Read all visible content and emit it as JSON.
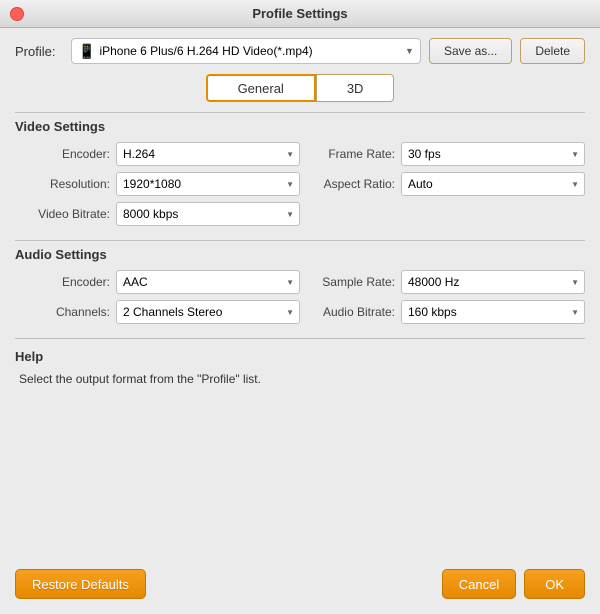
{
  "titleBar": {
    "title": "Profile Settings"
  },
  "profileRow": {
    "label": "Profile:",
    "selectedValue": "iPhone 6 Plus/6 H.264 HD Video(*.mp4)",
    "saveAsLabel": "Save as...",
    "deleteLabel": "Delete"
  },
  "tabs": [
    {
      "id": "general",
      "label": "General",
      "active": true
    },
    {
      "id": "3d",
      "label": "3D",
      "active": false
    }
  ],
  "videoSettings": {
    "title": "Video Settings",
    "fields": [
      {
        "label": "Encoder:",
        "value": "H.264",
        "col": 0
      },
      {
        "label": "Frame Rate:",
        "value": "30 fps",
        "col": 1
      },
      {
        "label": "Resolution:",
        "value": "1920*1080",
        "col": 0
      },
      {
        "label": "Aspect Ratio:",
        "value": "Auto",
        "col": 1
      },
      {
        "label": "Video Bitrate:",
        "value": "8000 kbps",
        "col": 0
      }
    ]
  },
  "audioSettings": {
    "title": "Audio Settings",
    "fields": [
      {
        "label": "Encoder:",
        "value": "AAC",
        "col": 0
      },
      {
        "label": "Sample Rate:",
        "value": "48000 Hz",
        "col": 1
      },
      {
        "label": "Channels:",
        "value": "2 Channels Stereo",
        "col": 0
      },
      {
        "label": "Audio Bitrate:",
        "value": "160 kbps",
        "col": 1
      }
    ]
  },
  "help": {
    "title": "Help",
    "text": "Select the output format from the \"Profile\" list."
  },
  "footer": {
    "restoreDefaultsLabel": "Restore Defaults",
    "cancelLabel": "Cancel",
    "okLabel": "OK"
  }
}
